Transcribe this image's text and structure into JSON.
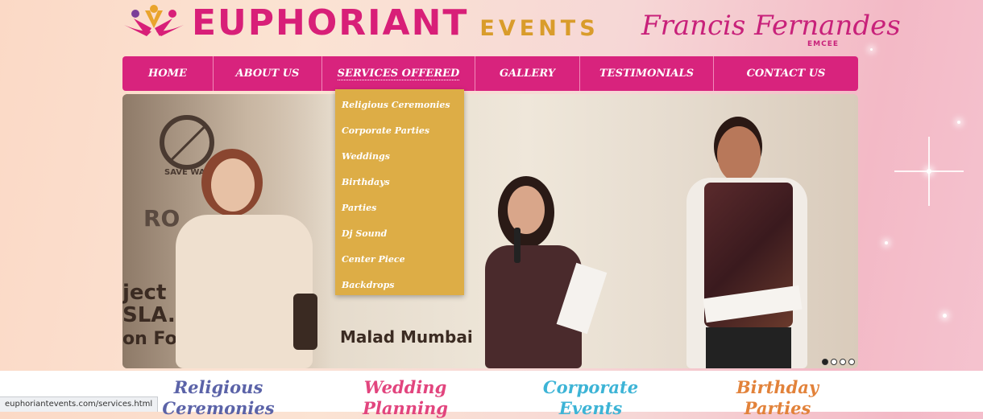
{
  "header": {
    "brand": "EUPHORIANT",
    "brand_sub": "EVENTS",
    "emcee_name": "Francis Fernandes",
    "emcee_role": "EMCEE"
  },
  "nav": {
    "items": [
      {
        "label": "HOME"
      },
      {
        "label": "ABOUT US"
      },
      {
        "label": "SERVICES OFFERED"
      },
      {
        "label": "GALLERY"
      },
      {
        "label": "TESTIMONIALS"
      },
      {
        "label": "CONTACT US"
      }
    ],
    "active": "SERVICES OFFERED"
  },
  "dropdown": {
    "items": [
      "Religious Ceremonies",
      "Corporate Parties",
      "Weddings",
      "Birthdays",
      "Parties",
      "Dj Sound",
      "Center Piece",
      "Backdrops"
    ]
  },
  "slider": {
    "text_lines": [
      "ject ... y :",
      "SLA... M.L.A.",
      "Malad Mumbai",
      "on Fo"
    ],
    "sign_text": "SAVE WA",
    "logo_text": "RO",
    "slide_count": 4,
    "active_slide": 1
  },
  "services": [
    {
      "line1": "Religious",
      "line2": "Ceremonies",
      "color": "#5b63a8"
    },
    {
      "line1": "Wedding",
      "line2": "Planning",
      "color": "#e2457e"
    },
    {
      "line1": "Corporate",
      "line2": "Events",
      "color": "#3db4d6"
    },
    {
      "line1": "Birthday",
      "line2": "Parties",
      "color": "#e2823a"
    }
  ],
  "status_bar": {
    "url": "euphoriantevents.com/services.html"
  },
  "colors": {
    "brand_pink": "#d8237d",
    "dropdown_gold": "#ddad46",
    "brand_gold": "#d99c2b"
  }
}
